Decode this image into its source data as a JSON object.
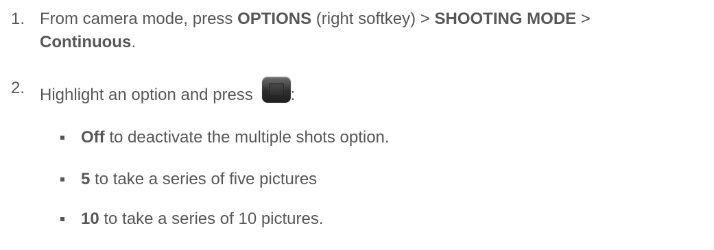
{
  "steps": [
    {
      "number": "1.",
      "parts": {
        "t1": "From camera mode, press ",
        "b1": "OPTIONS",
        "t2": " (right softkey) > ",
        "b2": "SHOOTING MODE",
        "t3": " > ",
        "b3": "Continuous",
        "t4": "."
      }
    },
    {
      "number": "2.",
      "parts": {
        "t1": "Highlight an option and press ",
        "icon": "center-key-icon",
        "t2": ":"
      }
    }
  ],
  "options": [
    {
      "bold": "Off",
      "text": " to deactivate the multiple shots option."
    },
    {
      "bold": "5",
      "text": " to take a series of five pictures"
    },
    {
      "bold": "10",
      "text": " to take a series of 10 pictures."
    }
  ]
}
